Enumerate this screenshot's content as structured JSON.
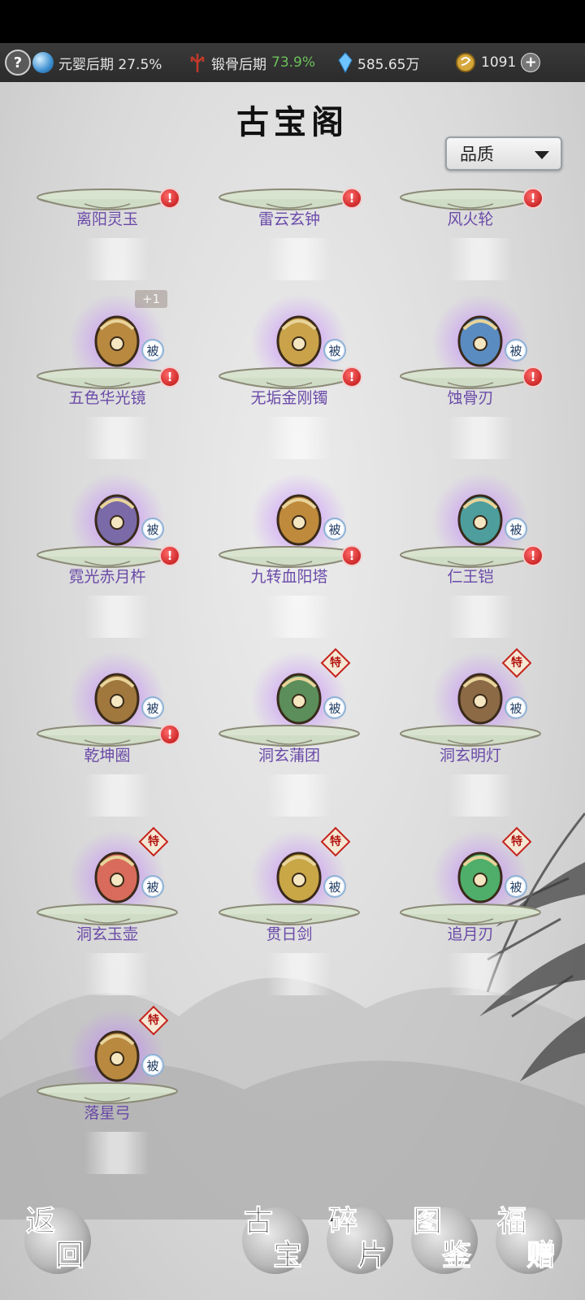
{
  "status_bar": {
    "help_icon_label": "?",
    "cultivation": "元婴后期 27.5%",
    "body_realm": "锻骨后期",
    "body_percent": "73.9%",
    "spirit_stones": "585.65万",
    "currency": "1091",
    "plus_label": "+"
  },
  "page_title": "古宝阁",
  "filter": {
    "selected": "品质"
  },
  "items": [
    {
      "name": "离阳灵玉",
      "alert": true,
      "passive": false,
      "special": false
    },
    {
      "name": "雷云玄钟",
      "alert": true,
      "passive": false,
      "special": false
    },
    {
      "name": "风火轮",
      "alert": true,
      "passive": false,
      "special": false
    },
    {
      "name": "五色华光镜",
      "alert": true,
      "passive": true,
      "special": false,
      "level": "+1"
    },
    {
      "name": "无垢金刚镯",
      "alert": true,
      "passive": true,
      "special": false
    },
    {
      "name": "蚀骨刃",
      "alert": true,
      "passive": true,
      "special": false
    },
    {
      "name": "霓光赤月杵",
      "alert": true,
      "passive": true,
      "special": false
    },
    {
      "name": "九转血阳塔",
      "alert": true,
      "passive": true,
      "special": false
    },
    {
      "name": "仁王铠",
      "alert": true,
      "passive": true,
      "special": false
    },
    {
      "name": "乾坤圈",
      "alert": true,
      "passive": true,
      "special": false
    },
    {
      "name": "洞玄蒲团",
      "alert": false,
      "passive": true,
      "special": true
    },
    {
      "name": "洞玄明灯",
      "alert": false,
      "passive": true,
      "special": true
    },
    {
      "name": "洞玄玉壶",
      "alert": false,
      "passive": true,
      "special": true
    },
    {
      "name": "贯日剑",
      "alert": false,
      "passive": true,
      "special": true
    },
    {
      "name": "追月刃",
      "alert": false,
      "passive": true,
      "special": true
    },
    {
      "name": "落星弓",
      "alert": false,
      "passive": true,
      "special": true
    }
  ],
  "badges": {
    "alert": "!",
    "passive": "被",
    "special": "特"
  },
  "bottom_nav": {
    "back": [
      "返",
      "回"
    ],
    "treasure": [
      "古",
      "宝"
    ],
    "fragments": [
      "碎",
      "片"
    ],
    "catalog": [
      "图",
      "鉴"
    ],
    "gift": [
      "福",
      "赠"
    ]
  }
}
